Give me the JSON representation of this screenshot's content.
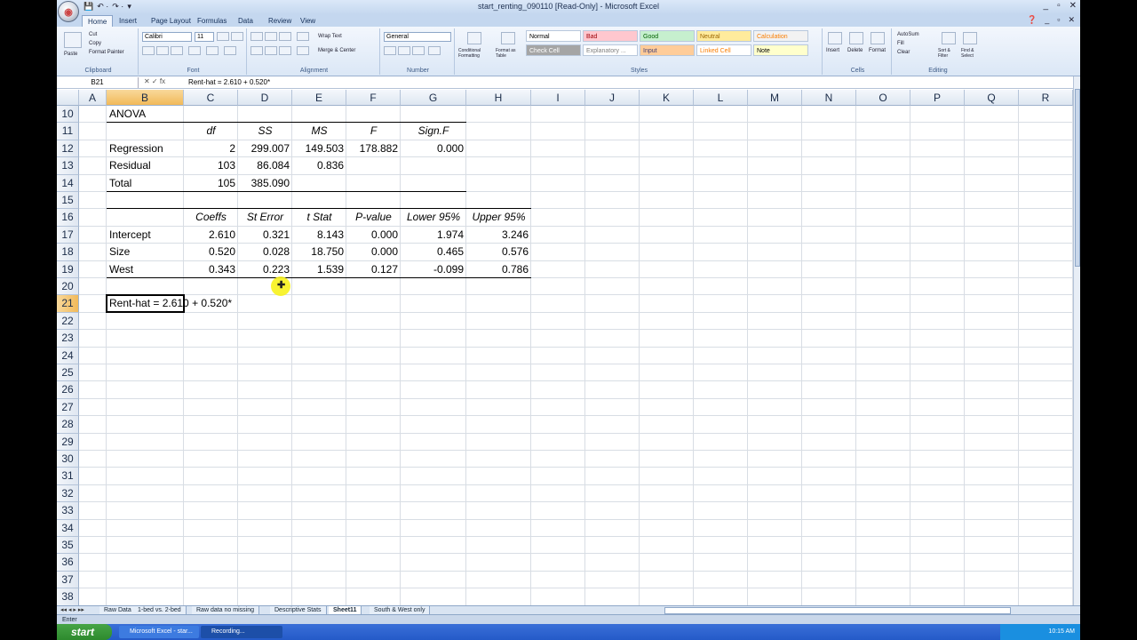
{
  "window": {
    "title": "start_renting_090110  [Read-Only] - Microsoft Excel",
    "controls": [
      "_",
      "▫",
      "✕"
    ]
  },
  "qat": [
    "💾",
    "↶ ·",
    "↷ ·",
    "▾"
  ],
  "tabs": [
    "Home",
    "Insert",
    "Page Layout",
    "Formulas",
    "Data",
    "Review",
    "View"
  ],
  "ribbon": {
    "clipboard": {
      "label": "Clipboard",
      "paste": "Paste",
      "cut": "Cut",
      "copy": "Copy",
      "format_painter": "Format Painter"
    },
    "font": {
      "label": "Font",
      "name": "Calibri",
      "size": "11"
    },
    "alignment": {
      "label": "Alignment",
      "wrap": "Wrap Text",
      "merge": "Merge & Center"
    },
    "number": {
      "label": "Number",
      "format": "General"
    },
    "styles": {
      "label": "Styles",
      "conditional": "Conditional Formatting",
      "format_table": "Format as Table",
      "cells": [
        {
          "name": "Normal",
          "bg": "#ffffff",
          "fg": "#000000"
        },
        {
          "name": "Bad",
          "bg": "#ffc7ce",
          "fg": "#9c0006"
        },
        {
          "name": "Good",
          "bg": "#c6efce",
          "fg": "#006100"
        },
        {
          "name": "Neutral",
          "bg": "#ffeb9c",
          "fg": "#9c6500"
        },
        {
          "name": "Calculation",
          "bg": "#f2f2f2",
          "fg": "#fa7d00"
        },
        {
          "name": "Check Cell",
          "bg": "#a5a5a5",
          "fg": "#ffffff"
        },
        {
          "name": "Explanatory ...",
          "bg": "#ffffff",
          "fg": "#7f7f7f"
        },
        {
          "name": "Input",
          "bg": "#ffcc99",
          "fg": "#3f3f76"
        },
        {
          "name": "Linked Cell",
          "bg": "#ffffff",
          "fg": "#fa7d00"
        },
        {
          "name": "Note",
          "bg": "#ffffcc",
          "fg": "#000000"
        }
      ]
    },
    "cells": {
      "label": "Cells",
      "insert": "Insert",
      "delete": "Delete",
      "format": "Format"
    },
    "editing": {
      "label": "Editing",
      "autosum": "AutoSum",
      "fill": "Fill",
      "clear": "Clear",
      "sort": "Sort & Filter",
      "find": "Find & Select"
    }
  },
  "formula_bar": {
    "name_box": "B21",
    "icons": "✕ ✓ fx",
    "content": "Rent-hat = 2.610 + 0.520*"
  },
  "columns": [
    "A",
    "B",
    "C",
    "D",
    "E",
    "F",
    "G",
    "H",
    "I",
    "J",
    "K",
    "L",
    "M",
    "N",
    "O",
    "P",
    "Q",
    "R"
  ],
  "rows": [
    "10",
    "11",
    "12",
    "13",
    "14",
    "15",
    "16",
    "17",
    "18",
    "19",
    "20",
    "21",
    "22",
    "23",
    "24",
    "25",
    "26",
    "27",
    "28",
    "29",
    "30",
    "31",
    "32",
    "33",
    "34",
    "35",
    "36",
    "37",
    "38"
  ],
  "selected_column": "B",
  "selected_row": "21",
  "cells": [
    {
      "row": "10",
      "col": "B",
      "value": "ANOVA",
      "kind": "txt"
    },
    {
      "row": "11",
      "col": "C",
      "value": "df",
      "kind": "hdr"
    },
    {
      "row": "11",
      "col": "D",
      "value": "SS",
      "kind": "hdr"
    },
    {
      "row": "11",
      "col": "E",
      "value": "MS",
      "kind": "hdr"
    },
    {
      "row": "11",
      "col": "F",
      "value": "F",
      "kind": "hdr"
    },
    {
      "row": "11",
      "col": "G",
      "value": "Sign.F",
      "kind": "hdr"
    },
    {
      "row": "12",
      "col": "B",
      "value": "Regression",
      "kind": "txt"
    },
    {
      "row": "12",
      "col": "C",
      "value": "2",
      "kind": "num"
    },
    {
      "row": "12",
      "col": "D",
      "value": "299.007",
      "kind": "num"
    },
    {
      "row": "12",
      "col": "E",
      "value": "149.503",
      "kind": "num"
    },
    {
      "row": "12",
      "col": "F",
      "value": "178.882",
      "kind": "num"
    },
    {
      "row": "12",
      "col": "G",
      "value": "0.000",
      "kind": "num"
    },
    {
      "row": "13",
      "col": "B",
      "value": "Residual",
      "kind": "txt"
    },
    {
      "row": "13",
      "col": "C",
      "value": "103",
      "kind": "num"
    },
    {
      "row": "13",
      "col": "D",
      "value": "86.084",
      "kind": "num"
    },
    {
      "row": "13",
      "col": "E",
      "value": "0.836",
      "kind": "num"
    },
    {
      "row": "14",
      "col": "B",
      "value": "Total",
      "kind": "txt"
    },
    {
      "row": "14",
      "col": "C",
      "value": "105",
      "kind": "num"
    },
    {
      "row": "14",
      "col": "D",
      "value": "385.090",
      "kind": "num"
    },
    {
      "row": "16",
      "col": "C",
      "value": "Coeffs",
      "kind": "hdr"
    },
    {
      "row": "16",
      "col": "D",
      "value": "St Error",
      "kind": "hdr"
    },
    {
      "row": "16",
      "col": "E",
      "value": "t Stat",
      "kind": "hdr"
    },
    {
      "row": "16",
      "col": "F",
      "value": "P-value",
      "kind": "hdr"
    },
    {
      "row": "16",
      "col": "G",
      "value": "Lower 95%",
      "kind": "hdr"
    },
    {
      "row": "16",
      "col": "H",
      "value": "Upper 95%",
      "kind": "hdr"
    },
    {
      "row": "17",
      "col": "B",
      "value": "Intercept",
      "kind": "txt"
    },
    {
      "row": "17",
      "col": "C",
      "value": "2.610",
      "kind": "num"
    },
    {
      "row": "17",
      "col": "D",
      "value": "0.321",
      "kind": "num"
    },
    {
      "row": "17",
      "col": "E",
      "value": "8.143",
      "kind": "num"
    },
    {
      "row": "17",
      "col": "F",
      "value": "0.000",
      "kind": "num"
    },
    {
      "row": "17",
      "col": "G",
      "value": "1.974",
      "kind": "num"
    },
    {
      "row": "17",
      "col": "H",
      "value": "3.246",
      "kind": "num"
    },
    {
      "row": "18",
      "col": "B",
      "value": "Size",
      "kind": "txt"
    },
    {
      "row": "18",
      "col": "C",
      "value": "0.520",
      "kind": "num"
    },
    {
      "row": "18",
      "col": "D",
      "value": "0.028",
      "kind": "num"
    },
    {
      "row": "18",
      "col": "E",
      "value": "18.750",
      "kind": "num"
    },
    {
      "row": "18",
      "col": "F",
      "value": "0.000",
      "kind": "num"
    },
    {
      "row": "18",
      "col": "G",
      "value": "0.465",
      "kind": "num"
    },
    {
      "row": "18",
      "col": "H",
      "value": "0.576",
      "kind": "num"
    },
    {
      "row": "19",
      "col": "B",
      "value": "West",
      "kind": "txt"
    },
    {
      "row": "19",
      "col": "C",
      "value": "0.343",
      "kind": "num"
    },
    {
      "row": "19",
      "col": "D",
      "value": "0.223",
      "kind": "num"
    },
    {
      "row": "19",
      "col": "E",
      "value": "1.539",
      "kind": "num"
    },
    {
      "row": "19",
      "col": "F",
      "value": "0.127",
      "kind": "num"
    },
    {
      "row": "19",
      "col": "G",
      "value": "-0.099",
      "kind": "num"
    },
    {
      "row": "19",
      "col": "H",
      "value": "0.786",
      "kind": "num"
    },
    {
      "row": "21",
      "col": "B",
      "value": "Rent-hat = 2.610 + 0.520*",
      "kind": "txt"
    }
  ],
  "sheet_tabs": [
    "Raw Data",
    "1-bed vs. 2-bed",
    "Raw data no missing",
    "Descriptive Stats",
    "Sheet11",
    "South & West only"
  ],
  "active_sheet": "Sheet11",
  "status": "Enter",
  "taskbar": {
    "start": "start",
    "items": [
      "Microsoft Excel - star...",
      "Recording..."
    ],
    "clock": "10:15 AM"
  }
}
